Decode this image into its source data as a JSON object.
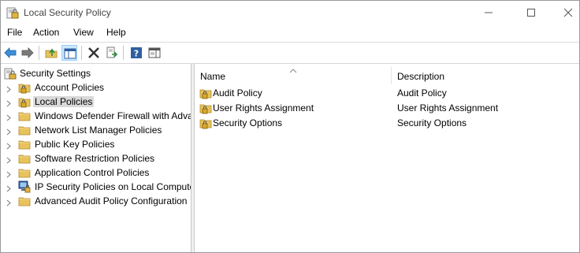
{
  "window": {
    "title": "Local Security Policy",
    "icon": "security-policy-icon"
  },
  "menu": [
    "File",
    "Action",
    "View",
    "Help"
  ],
  "toolbar": {
    "buttons": [
      "back-arrow-icon",
      "forward-arrow-icon",
      "up-folder-icon",
      "show-hide-tree-icon",
      "delete-icon",
      "export-list-icon",
      "help-icon",
      "properties-pane-icon"
    ]
  },
  "tree": {
    "root": "Security Settings",
    "items": [
      {
        "label": "Account Policies",
        "icon": "locked-folder-icon"
      },
      {
        "label": "Local Policies",
        "icon": "locked-folder-icon",
        "selected": true
      },
      {
        "label": "Windows Defender Firewall with Adva",
        "icon": "folder-icon"
      },
      {
        "label": "Network List Manager Policies",
        "icon": "folder-icon"
      },
      {
        "label": "Public Key Policies",
        "icon": "folder-icon"
      },
      {
        "label": "Software Restriction Policies",
        "icon": "folder-icon"
      },
      {
        "label": "Application Control Policies",
        "icon": "folder-icon"
      },
      {
        "label": "IP Security Policies on Local Compute",
        "icon": "ip-security-icon"
      },
      {
        "label": "Advanced Audit Policy Configuration",
        "icon": "folder-icon"
      }
    ]
  },
  "list": {
    "columns": [
      "Name",
      "Description"
    ],
    "rows": [
      {
        "name": "Audit Policy",
        "description": "Audit Policy"
      },
      {
        "name": "User Rights Assignment",
        "description": "User Rights Assignment"
      },
      {
        "name": "Security Options",
        "description": "Security Options"
      }
    ]
  },
  "colors": {
    "selection": "#d9d9d9",
    "folder": "#e8c25c",
    "toolbar_pressed": "#cde8ff",
    "nav_arrow": "#3c8fd8"
  }
}
